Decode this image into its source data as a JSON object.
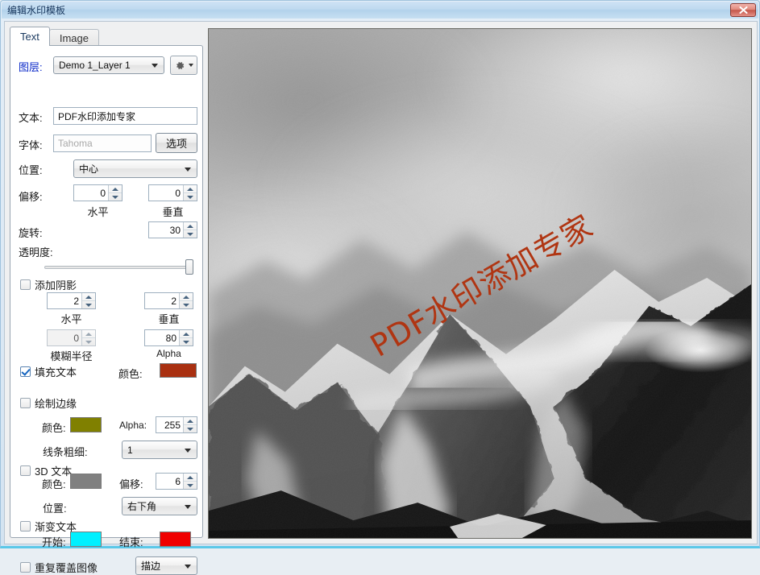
{
  "window": {
    "title": "编辑水印模板",
    "close_label": "close-button"
  },
  "tabs": [
    {
      "label": "Text",
      "active": true
    },
    {
      "label": "Image",
      "active": false
    }
  ],
  "form": {
    "layer": {
      "label": "图层:",
      "value": "Demo 1_Layer 1",
      "settings_button": "gear"
    },
    "text": {
      "label": "文本:",
      "value": "PDF水印添加专家"
    },
    "font": {
      "label": "字体:",
      "value": "Tahoma",
      "options_button": "选项"
    },
    "position": {
      "label": "位置:",
      "value": "中心"
    },
    "offset": {
      "label": "偏移:",
      "horizontal_value": "0",
      "horizontal_label": "水平",
      "vertical_value": "0",
      "vertical_label": "垂直"
    },
    "rotation": {
      "label": "旋转:",
      "value": "30"
    },
    "opacity": {
      "label": "透明度:",
      "percent": 100
    },
    "shadow": {
      "label": "添加阴影",
      "checked": false,
      "horizontal_value": "2",
      "horizontal_label": "水平",
      "vertical_value": "2",
      "vertical_label": "垂直",
      "blur_value": "0",
      "blur_label": "模糊半径",
      "alpha_value": "80",
      "alpha_label": "Alpha"
    },
    "fill_text": {
      "label": "填充文本",
      "checked": true,
      "color_label": "颜色:",
      "color": "#A93011"
    },
    "draw_edge": {
      "label": "绘制边缘",
      "checked": false,
      "color_label": "颜色:",
      "color": "#808000",
      "alpha_label": "Alpha:",
      "alpha_value": "255",
      "thickness_label": "线条粗细:",
      "thickness_value": "1"
    },
    "text_3d": {
      "label": "3D 文本",
      "checked": false,
      "color_label": "颜色:",
      "color": "#808080",
      "offset_label": "偏移:",
      "offset_value": "6",
      "position_label": "位置:",
      "position_value": "右下角"
    },
    "gradient_text": {
      "label": "渐变文本",
      "checked": false,
      "start_label": "开始:",
      "start_color": "#00F0FF",
      "end_label": "结束:",
      "end_color": "#F00000"
    },
    "tile": {
      "label": "重复覆盖图像",
      "checked": false,
      "mode_value": "描边"
    }
  },
  "preview": {
    "watermark_text": "PDF水印添加专家",
    "watermark_color": "#B03512",
    "watermark_rotation_deg": 30,
    "image_description": "grayscale mountain peak photo"
  }
}
